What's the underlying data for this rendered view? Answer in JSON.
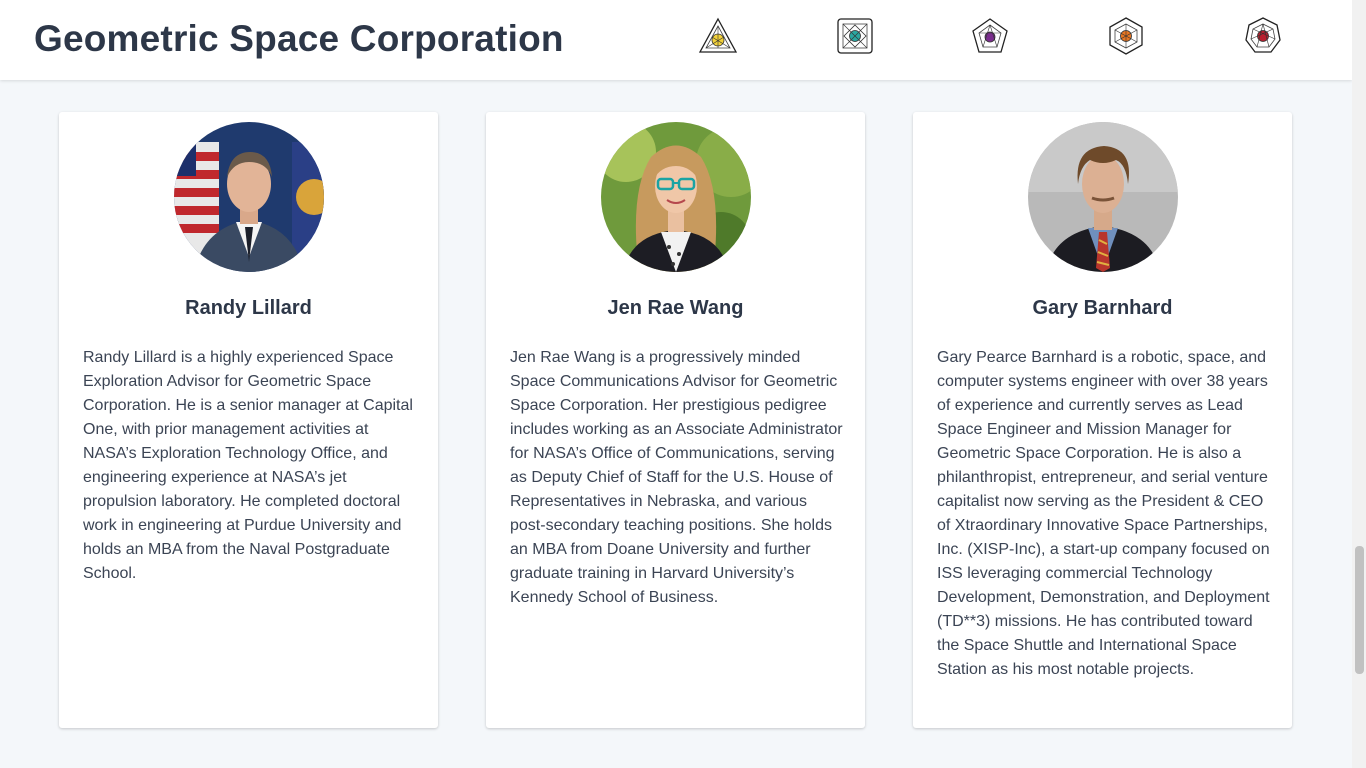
{
  "header": {
    "title": "Geometric Space Corporation",
    "nav_icons": [
      {
        "icon": "triangle-logo-icon",
        "accent": "#f2d13a"
      },
      {
        "icon": "square-logo-icon",
        "accent": "#2aa7a0"
      },
      {
        "icon": "pentagon-logo-icon",
        "accent": "#7b2d8e"
      },
      {
        "icon": "hexagon-logo-icon",
        "accent": "#e87722"
      },
      {
        "icon": "heptagon-logo-icon",
        "accent": "#b8202f"
      }
    ]
  },
  "team": [
    {
      "name": "Randy Lillard",
      "photo": "randy-lillard-portrait",
      "bio": "Randy Lillard is a highly experienced Space Exploration Advisor for Geometric Space Corporation. He is a senior manager at Capital One, with prior management activities at NASA’s Exploration Technology Office, and engineering experience at NASA’s jet propulsion laboratory. He completed doctoral work in engineering at Purdue University and holds an MBA from the Naval Postgraduate School."
    },
    {
      "name": "Jen Rae Wang",
      "photo": "jen-rae-wang-portrait",
      "bio": "Jen Rae Wang is a progressively minded Space Communications Advisor for Geometric Space Corporation. Her prestigious pedigree includes working as an Associate Administrator for NASA’s Office of Communications, serving as Deputy Chief of Staff for the U.S. House of Representatives in Nebraska, and various post-secondary teaching positions. She holds an MBA from Doane University and further graduate training in Harvard University’s Kennedy School of Business."
    },
    {
      "name": "Gary Barnhard",
      "photo": "gary-barnhard-portrait",
      "bio": "Gary Pearce Barnhard is a robotic, space, and computer systems engineer with over 38 years of experience and currently serves as Lead Space Engineer and Mission Manager for Geometric Space Corporation. He is also a philanthropist, entrepreneur, and serial venture capitalist now serving as the President & CEO of Xtraordinary Innovative Space Partnerships, Inc. (XISP-Inc), a start-up company focused on ISS leveraging commercial Technology Development, Demonstration, and Deployment (TD**3) missions. He has contributed toward the Space Shuttle and International Space Station as his most notable projects."
    }
  ]
}
